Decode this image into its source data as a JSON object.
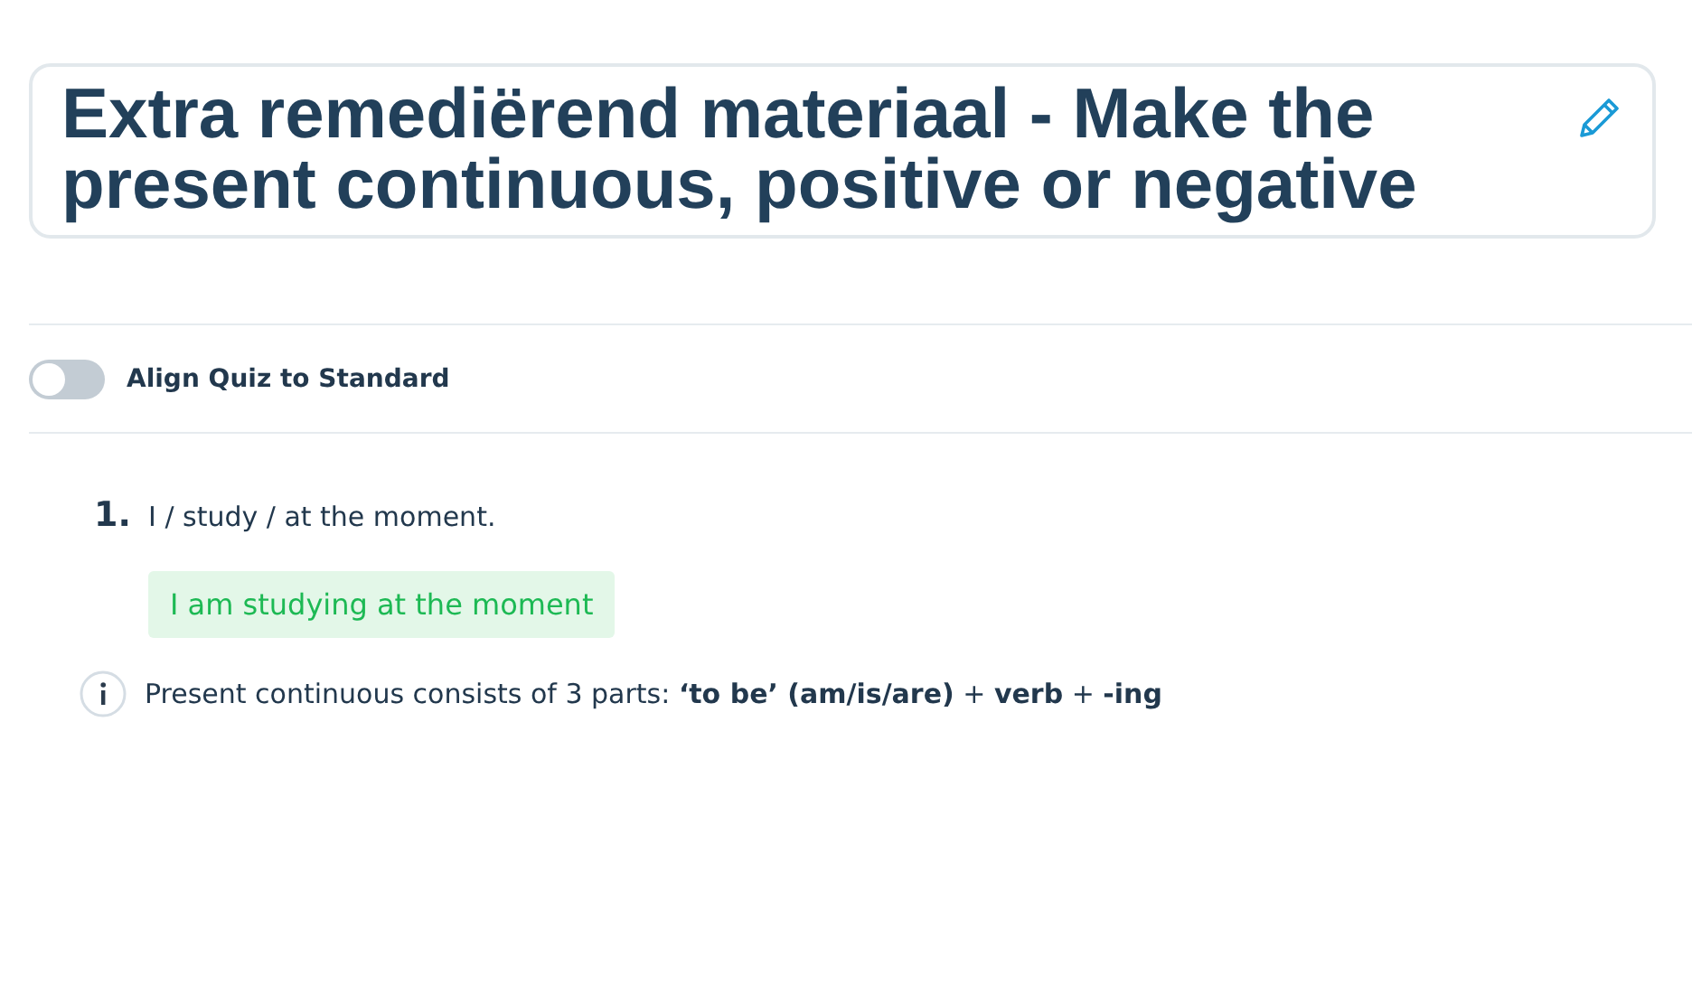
{
  "title": "Extra remediërend materiaal - Make the present continuous, positive or negative",
  "align_toggle": {
    "label": "Align Quiz to Standard",
    "on": false
  },
  "questions": [
    {
      "number": "1.",
      "prompt": "I / study / at the moment.",
      "answer": "I am studying at the moment",
      "hint": "Present continuous consists of 3 parts: **‘to be’ (am/is/are)** + **verb** + **-ing**"
    }
  ]
}
